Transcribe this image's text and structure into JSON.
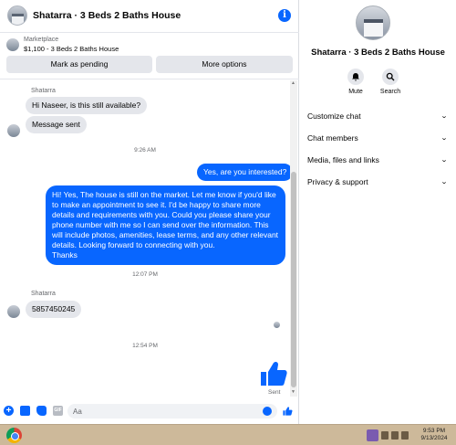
{
  "chat": {
    "title": "Shatarra · 3 Beds 2 Baths House",
    "marketplace_label": "Marketplace",
    "listing": "$1,100 - 3 Beds 2 Baths House",
    "mark_pending_label": "Mark as pending",
    "more_options_label": "More options"
  },
  "messages": {
    "sender_name_1": "Shatarra",
    "msg_1": "Hi Naseer, is this still available?",
    "msg_2": "Message sent",
    "time_1": "9:26 AM",
    "msg_3": "Yes, are you interested?",
    "msg_4": "Hi! Yes, The house is still on the market. Let me know if you'd like to make an appointment to see it. I'd be happy to share more details and requirements with you. Could you please share your phone number with me so I can send over the information. This will include photos, amenities, lease terms, and any other relevant details. Looking forward to connecting with you.\nThanks",
    "time_2": "12:07 PM",
    "sender_name_2": "Shatarra",
    "msg_5": "5857450245",
    "time_3": "12:54 PM",
    "sent_status": "Sent"
  },
  "composer": {
    "placeholder": "Aa",
    "gif_label": "GIF"
  },
  "details": {
    "title": "Shatarra · 3 Beds 2 Baths House",
    "mute_label": "Mute",
    "search_label": "Search",
    "sections": [
      "Customize chat",
      "Chat members",
      "Media, files and links",
      "Privacy & support"
    ]
  },
  "taskbar": {
    "time": "9:53 PM",
    "date": "9/13/2024"
  },
  "colors": {
    "accent": "#0866ff",
    "bubble_in": "#e4e6eb",
    "taskbar": "#cdb99a"
  },
  "icons": [
    "info-icon",
    "plus-icon",
    "photo-icon",
    "sticker-icon",
    "gif-icon",
    "emoji-icon",
    "like-icon",
    "bell-icon",
    "search-icon",
    "chevron-down-icon",
    "start-icon"
  ]
}
